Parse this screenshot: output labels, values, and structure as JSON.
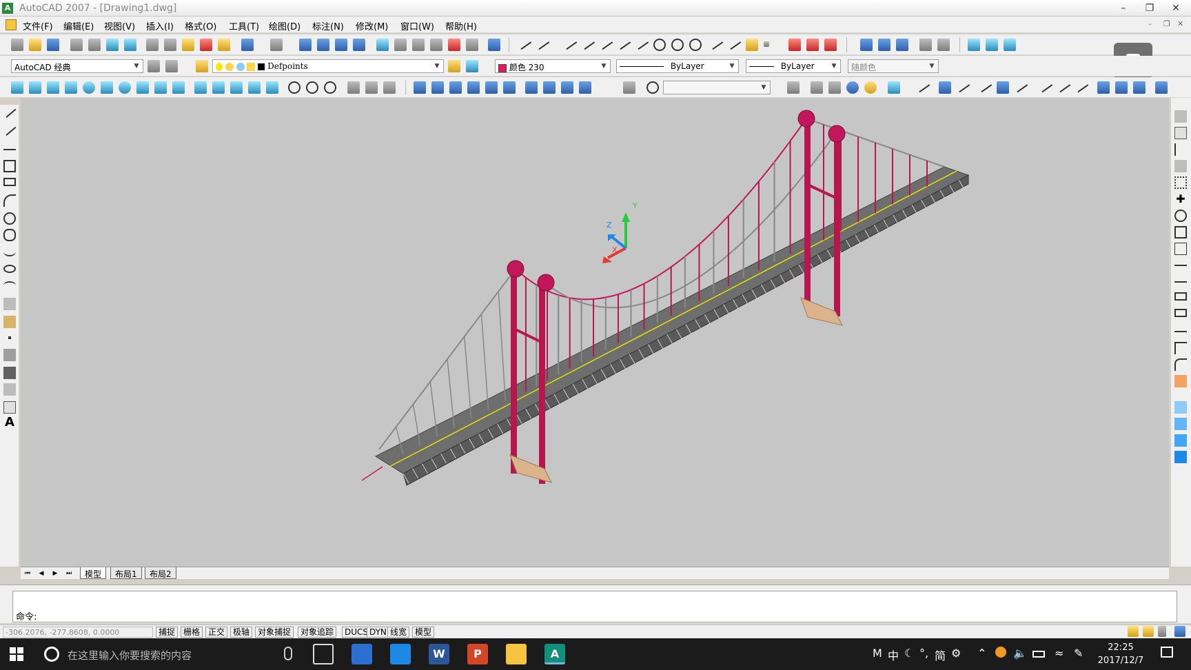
{
  "window": {
    "title": "AutoCAD 2007 - [Drawing1.dwg]",
    "app_icon_letter": "A"
  },
  "menu": {
    "items": [
      "文件(F)",
      "编辑(E)",
      "视图(V)",
      "插入(I)",
      "格式(O)",
      "工具(T)",
      "绘图(D)",
      "标注(N)",
      "修改(M)",
      "窗口(W)",
      "帮助(H)"
    ]
  },
  "toolbar": {
    "workspace": "AutoCAD 经典",
    "layer": "Defpoints",
    "color": "颜色 230",
    "color_swatch": "#e6195a",
    "linetype": "ByLayer",
    "lineweight": "ByLayer",
    "plotstyle": "随颜色"
  },
  "tabs": {
    "model": "模型",
    "layout1": "布局1",
    "layout2": "布局2"
  },
  "command": {
    "prompt": "命令:"
  },
  "status": {
    "coords": "-306.2076,  -277.8608,  0.0000",
    "buttons": [
      "捕捉",
      "栅格",
      "正交",
      "极轴",
      "对象捕捉",
      "对象追踪",
      "DUCS",
      "DYN",
      "线宽",
      "模型"
    ]
  },
  "ucs": {
    "x": "X",
    "y": "Y",
    "z": "Z"
  },
  "taskbar": {
    "search_placeholder": "在这里输入你要搜索的内容",
    "apps": [
      "edge",
      "qq",
      "word",
      "powerpoint",
      "explorer",
      "autocad"
    ],
    "ime_items": [
      "M",
      "中",
      "简"
    ],
    "time": "22:25",
    "date": "2017/12/7"
  },
  "colors": {
    "tower": "#b5174e",
    "deck": "#6e6e6e",
    "cable": "#c2185b",
    "foundation": "#dcb48c",
    "centerline": "#e8e000"
  }
}
